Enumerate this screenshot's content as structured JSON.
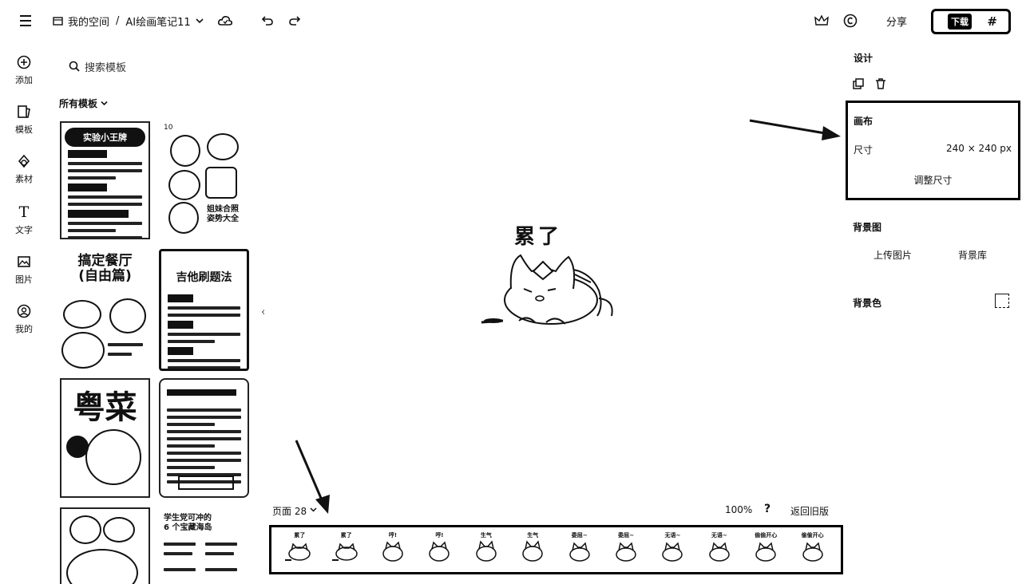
{
  "header": {
    "space_label": "我的空间",
    "separator": "/",
    "doc_title": "AI绘画笔记11",
    "share_label": "分享",
    "download_label": "下载",
    "more_label": "#"
  },
  "rail": {
    "items": [
      {
        "label": "添加",
        "icon": "plus-circle-icon"
      },
      {
        "label": "模板",
        "icon": "template-icon"
      },
      {
        "label": "素材",
        "icon": "shapes-icon"
      },
      {
        "label": "文字",
        "icon": "text-icon"
      },
      {
        "label": "图片",
        "icon": "image-icon"
      },
      {
        "label": "我的",
        "icon": "user-icon"
      }
    ]
  },
  "templates": {
    "search_placeholder": "搜索模板",
    "filter_label": "所有模板",
    "number_tag": "10",
    "cards": [
      {
        "heading": "实验小王牌"
      },
      {
        "caption": "姐妹合照\n姿势大全"
      },
      {
        "heading": "搞定餐厅\n(自由篇)"
      },
      {
        "heading": "吉他刷题法"
      },
      {
        "heading": "粤菜"
      },
      {
        "heading": ""
      },
      {
        "heading": ""
      },
      {
        "caption": "学生党可冲的\n6 个宝藏海岛"
      }
    ]
  },
  "canvas": {
    "sticker_text": "累了"
  },
  "right_panel": {
    "design_label": "设计",
    "canvas_label": "画布",
    "size_label": "尺寸",
    "size_value": "240 × 240 px",
    "resize_label": "调整尺寸",
    "bg_image_label": "背景图",
    "upload_label": "上传图片",
    "bg_library_label": "背景库",
    "bg_color_label": "背景色"
  },
  "footer": {
    "page_label": "页面 28",
    "zoom": "100%",
    "help": "?",
    "back_old": "返回旧版"
  },
  "pages": [
    {
      "label": "累了"
    },
    {
      "label": "累了"
    },
    {
      "label": "哼!"
    },
    {
      "label": "哼!"
    },
    {
      "label": "生气"
    },
    {
      "label": "生气"
    },
    {
      "label": "委屈~"
    },
    {
      "label": "委屈~"
    },
    {
      "label": "无语~"
    },
    {
      "label": "无语~"
    },
    {
      "label": "偷偷开心"
    },
    {
      "label": "偷偷开心"
    }
  ]
}
